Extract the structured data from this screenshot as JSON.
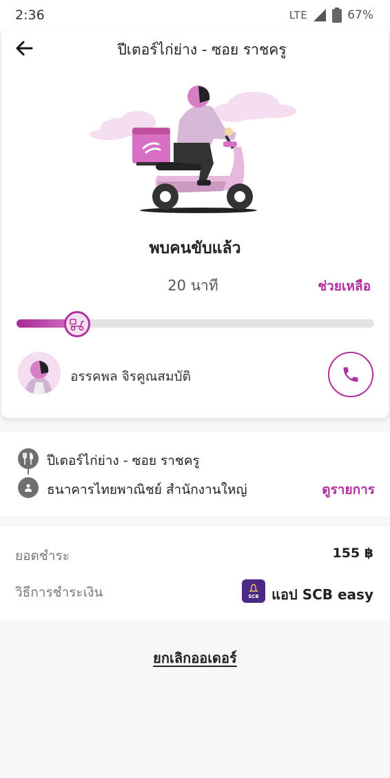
{
  "status_bar": {
    "time": "2:36",
    "network": "LTE",
    "battery": "67%"
  },
  "header": {
    "title": "ปีเตอร์ไก่ย่าง - ซอย ราชครู"
  },
  "order_status": {
    "driver_status": "พบคนขับแล้ว",
    "eta": "20 นาที",
    "help_label": "ช่วยเหลือ",
    "progress": 0.17
  },
  "driver": {
    "name": "อรรคพล จิรคูณสมบัติ"
  },
  "route": {
    "pickup": "ปีเตอร์ไก่ย่าง - ซอย ราชครู",
    "dropoff": "ธนาคารไทยพาณิชย์ สำนักงานใหญ่",
    "details_label": "ดูรายการ"
  },
  "payment": {
    "total_label": "ยอดชำระ",
    "total_amount": "155 ฿",
    "method_label": "วิธีการชำระเงิน",
    "method_name": "แอป SCB easy",
    "method_logo_text": "SCB"
  },
  "actions": {
    "cancel_label": "ยกเลิกออเดอร์"
  },
  "colors": {
    "accent": "#b02fa0",
    "rider_pink": "#d97fc8",
    "icon_grey": "#6f6f6f"
  },
  "icons": {
    "back": "arrow-left-icon",
    "phone": "phone-icon",
    "scooter": "scooter-icon",
    "restaurant": "fork-knife-icon",
    "person": "person-icon"
  }
}
